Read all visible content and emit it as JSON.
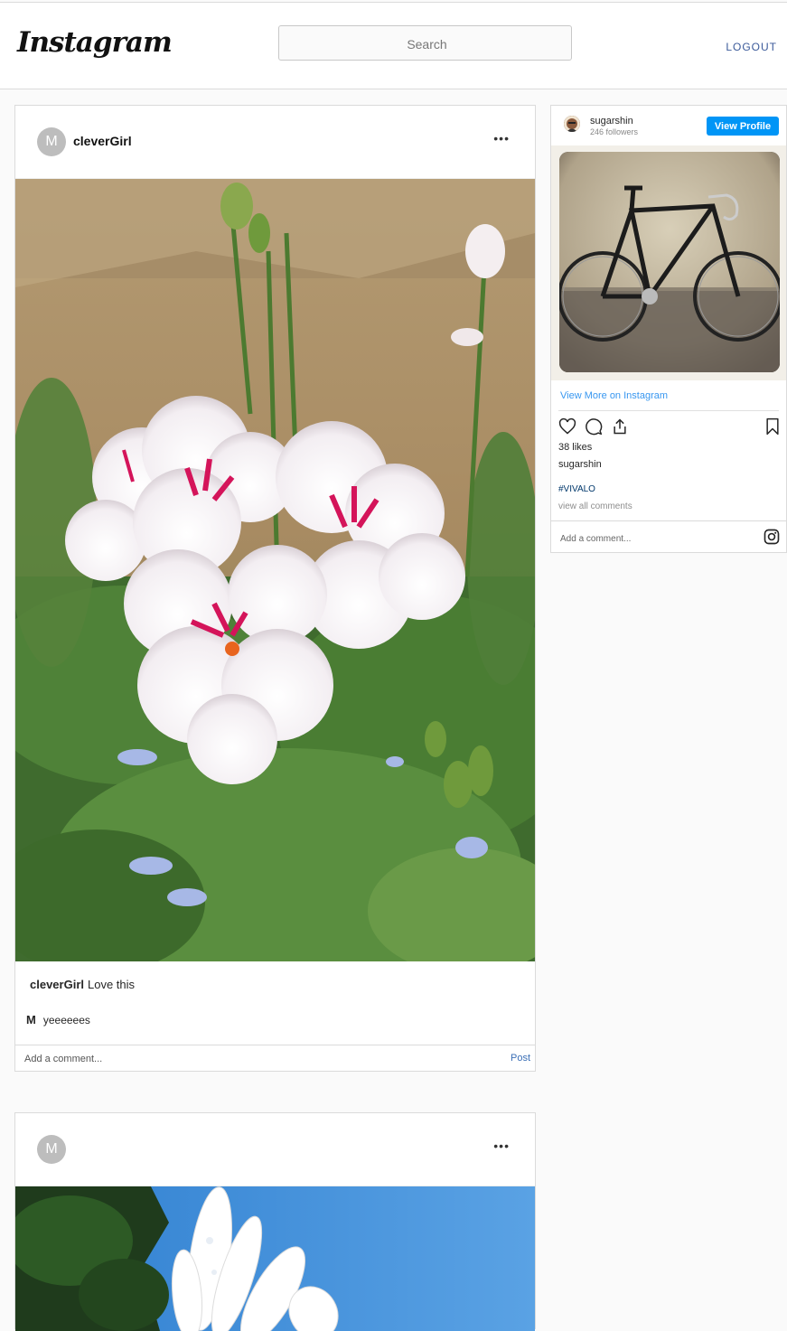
{
  "header": {
    "logo_text": "Instagram",
    "search_placeholder": "Search",
    "logout_label": "LOGOUT"
  },
  "posts": [
    {
      "avatar_initial": "M",
      "username": "cleverGirl",
      "more_label": "•••",
      "image_icon": "white-geranium-flowers-photo",
      "caption_user": "cleverGirl",
      "caption_text": "Love this",
      "comments": [
        {
          "user": "M",
          "text": "yeeeeees"
        }
      ],
      "add_comment_placeholder": "Add a comment...",
      "post_label": "Post"
    },
    {
      "avatar_initial": "M",
      "username": "",
      "more_label": "•••",
      "image_icon": "white-daisy-sky-photo"
    }
  ],
  "embed": {
    "username": "sugarshin",
    "followers": "246 followers",
    "view_profile_label": "View Profile",
    "photo_icon": "black-road-bicycle-photo",
    "view_more_label": "View More on Instagram",
    "likes": "38 likes",
    "owner": "sugarshin",
    "hashtag": "#VIVALO",
    "view_all_comments": "view all comments",
    "add_comment_placeholder": "Add a comment...",
    "icons": [
      "heart-icon",
      "comment-icon",
      "share-icon",
      "bookmark-icon",
      "instagram-icon"
    ],
    "accent_color": "#0095f6"
  }
}
